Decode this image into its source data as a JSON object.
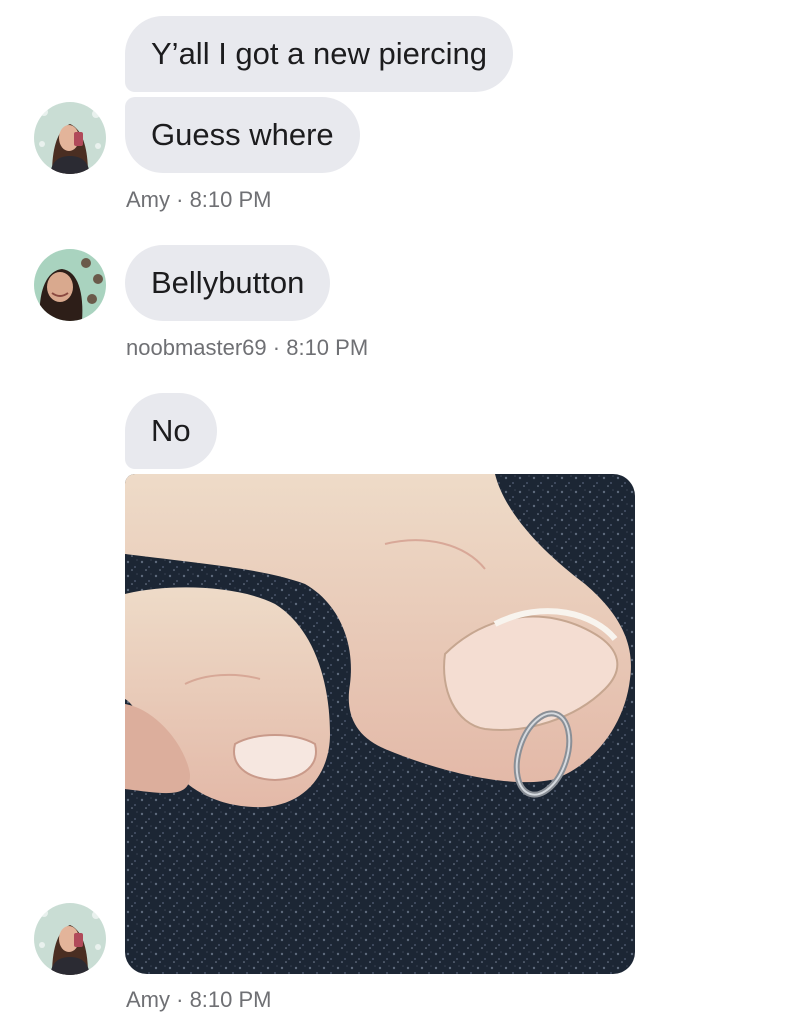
{
  "conversation": {
    "messages": [
      {
        "text": "Y’all I got a new piercing"
      },
      {
        "text": "Guess where"
      },
      {
        "text": "Bellybutton"
      },
      {
        "text": "No"
      }
    ],
    "timestamps": [
      {
        "sender": "Amy",
        "time": "8:10 PM"
      },
      {
        "sender": "noobmaster69",
        "time": "8:10 PM"
      },
      {
        "sender": "Amy",
        "time": "8:10 PM"
      }
    ],
    "separator": " · "
  },
  "colors": {
    "bubble": "#e8e9ee",
    "meta_text": "#6f7074",
    "background": "#ffffff"
  }
}
